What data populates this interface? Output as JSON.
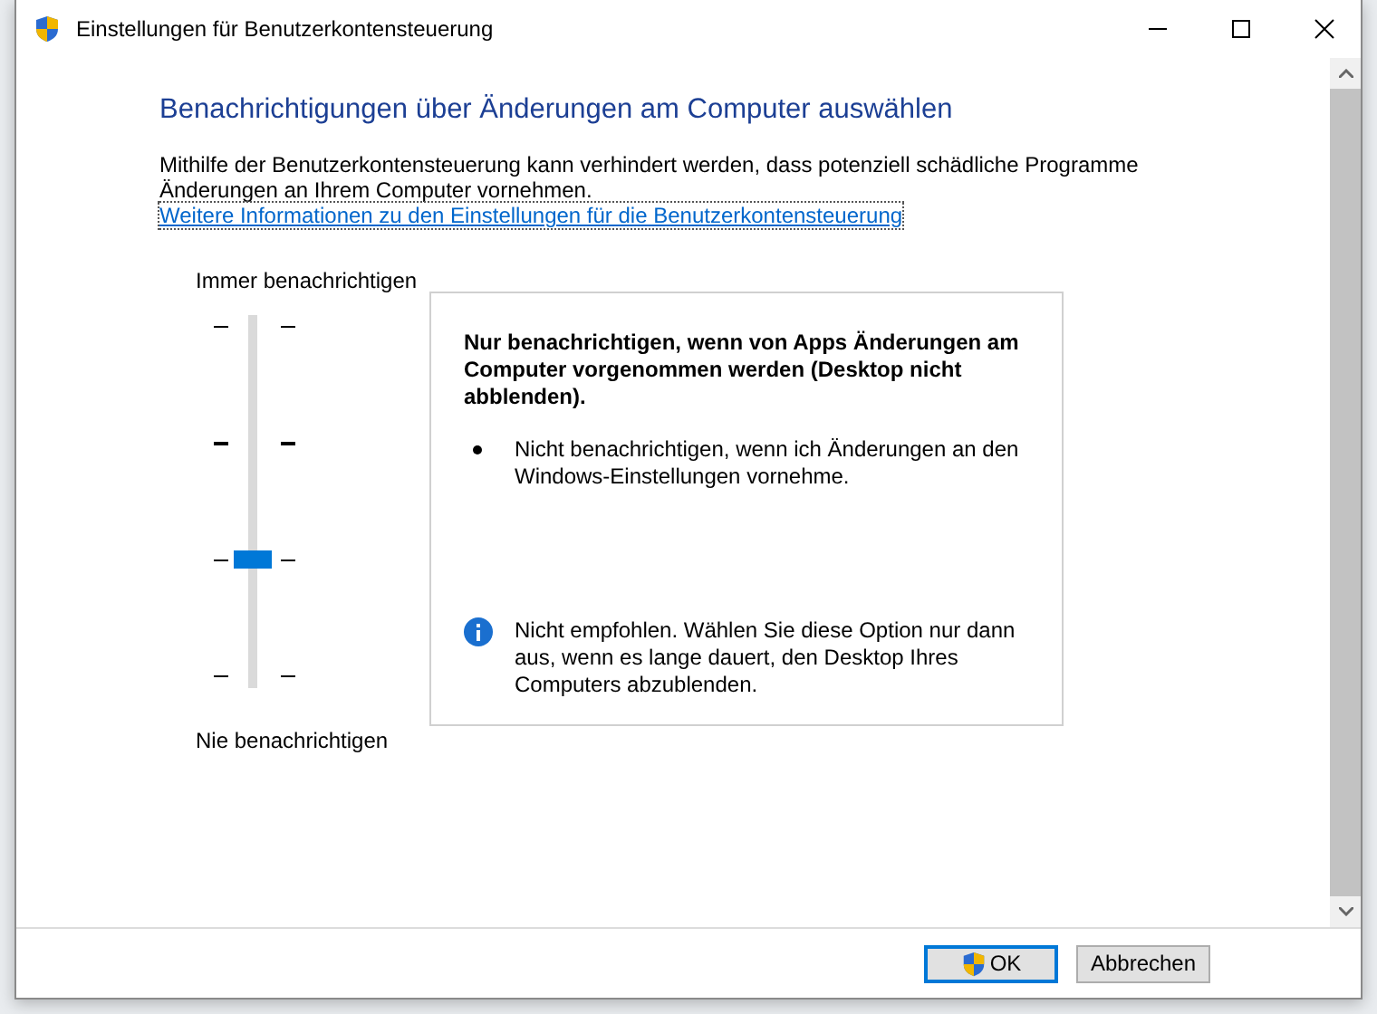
{
  "window": {
    "title": "Einstellungen für Benutzerkontensteuerung"
  },
  "heading": "Benachrichtigungen über Änderungen am Computer auswählen",
  "description": "Mithilfe der Benutzerkontensteuerung kann verhindert werden, dass potenziell schädliche Programme Änderungen an Ihrem Computer vornehmen.",
  "link": "Weitere Informationen zu den Einstellungen für die Benutzerkontensteuerung",
  "slider": {
    "top_label": "Immer benachrichtigen",
    "bottom_label": "Nie benachrichtigen",
    "level": 0.3333
  },
  "info_box": {
    "title": "Nur benachrichtigen, wenn von Apps Änderungen am Computer vorgenommen werden (Desktop nicht abblenden).",
    "bullets": [
      "Nicht benachrichtigen, wenn ich Änderungen an den Windows-Einstellungen vornehme."
    ],
    "note": "Nicht empfohlen. Wählen Sie diese Option nur dann aus, wenn es lange dauert, den Desktop Ihres Computers abzublenden."
  },
  "buttons": [
    {
      "label": "OK",
      "kind": "shield",
      "default": true
    },
    {
      "label": "Abbrechen",
      "kind": "plain",
      "default": false
    }
  ]
}
